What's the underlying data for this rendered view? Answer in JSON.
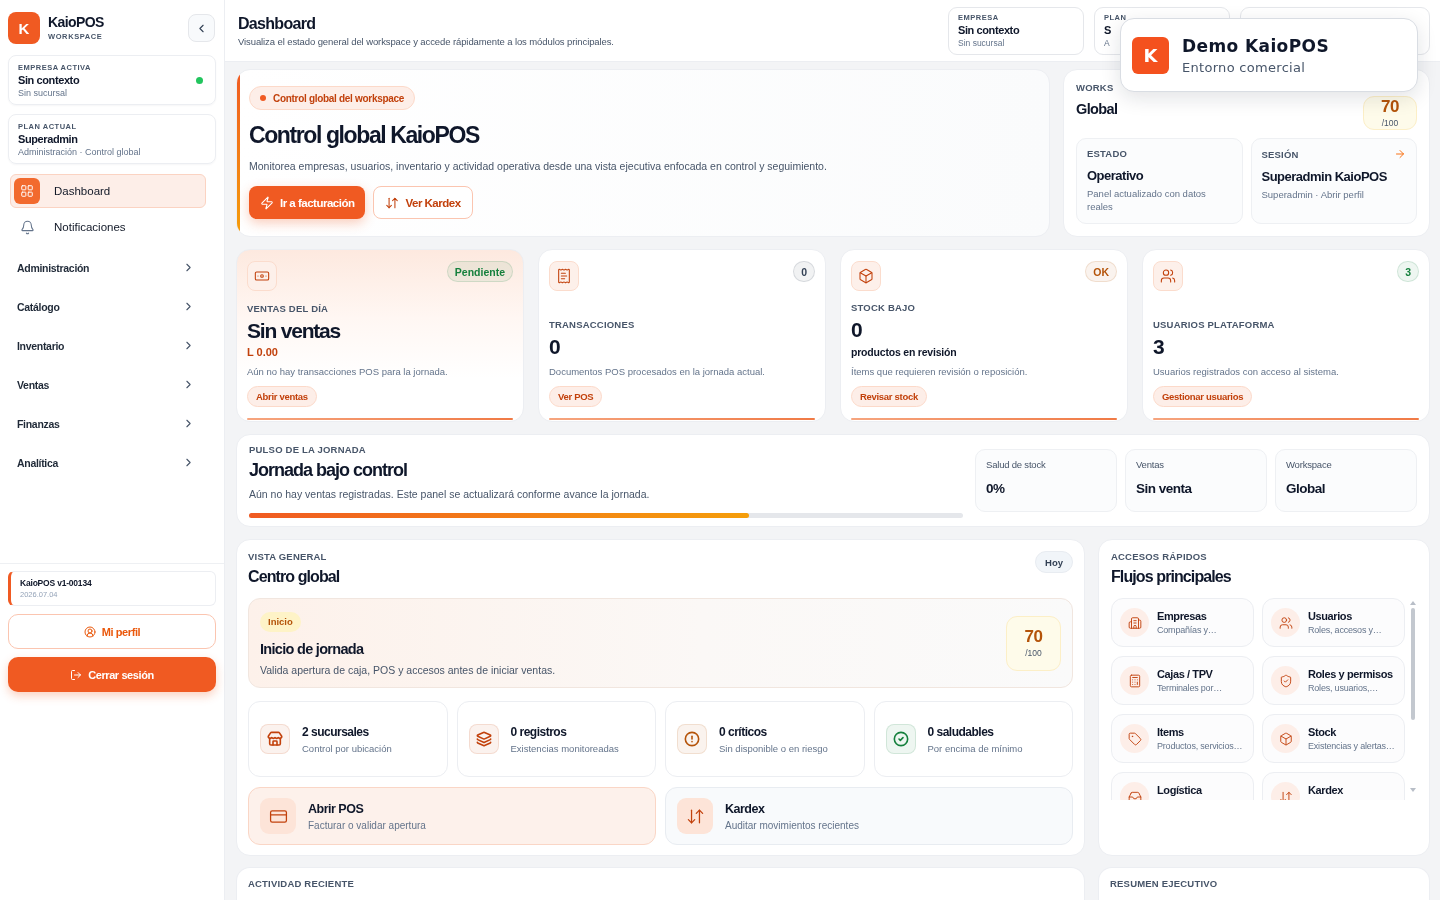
{
  "sidebar": {
    "brand": {
      "logo": "K",
      "name": "KaioPOS",
      "subtitle": "WORKSPACE"
    },
    "context_cards": [
      {
        "label": "EMPRESA ACTIVA",
        "value": "Sin contexto",
        "detail": "Sin sucursal",
        "online": true
      },
      {
        "label": "PLAN ACTUAL",
        "value": "Superadmin",
        "detail": "Administración · Control global"
      }
    ],
    "nav_items": [
      {
        "label": "Dashboard",
        "selected": true
      },
      {
        "label": "Notificaciones",
        "selected": false
      }
    ],
    "nav_groups": [
      {
        "label": "Administración",
        "expanded": false
      },
      {
        "label": "Catálogo",
        "expanded": false
      },
      {
        "label": "Inventario",
        "expanded": false
      },
      {
        "label": "Ventas",
        "expanded": false
      },
      {
        "label": "Finanzas",
        "expanded": false
      },
      {
        "label": "Analítica",
        "expanded": false
      }
    ],
    "version": {
      "name": "KaioPOS v1-00134",
      "date": "2026.07.04"
    },
    "buttons": [
      {
        "label": "Mi perfil",
        "kind": "outline"
      },
      {
        "label": "Cerrar sesión",
        "kind": "primary"
      }
    ]
  },
  "header": {
    "title": "Dashboard",
    "subtitle": "Visualiza el estado general del workspace y accede rápidamente a los módulos principales.",
    "context_cards": [
      {
        "kind": "info",
        "label": "EMPRESA",
        "value": "Sin contexto",
        "detail": "Sin sucursal"
      },
      {
        "kind": "info",
        "label": "PLAN",
        "value": "S",
        "detail": "A"
      },
      {
        "kind": "account"
      }
    ]
  },
  "toast": {
    "logo": "K",
    "title": "Demo KaioPOS",
    "subtitle": "Entorno comercial"
  },
  "hero": {
    "badge": "Control global del workspace",
    "title": "Control global KaioPOS",
    "description": "Monitorea empresas, usuarios, inventario y actividad operativa desde una vista ejecutiva enfocada en control y seguimiento.",
    "buttons": [
      {
        "label": "Ir a facturación",
        "kind": "primary"
      },
      {
        "label": "Ver Kardex",
        "kind": "outline"
      }
    ]
  },
  "workspace": {
    "label": "WORKS",
    "value": "Global",
    "score": "70",
    "score_max": "/100",
    "tiles": [
      {
        "label": "ESTADO",
        "value": "Operativo",
        "detail": "Panel actualizado con datos reales",
        "link": false
      },
      {
        "label": "SESIÓN",
        "value": "Superadmin KaioPOS",
        "detail": "Superadmin · Abrir perfil",
        "link": true
      }
    ]
  },
  "stats": [
    {
      "label": "VENTAS DEL DÍA",
      "value": "Sin ventas",
      "amount": "L 0.00",
      "description": "Aún no hay transacciones POS para la jornada.",
      "action": "Abrir ventas",
      "badge": {
        "text": "Pendiente",
        "color": "#15803d"
      },
      "highlighted": true
    },
    {
      "label": "TRANSACCIONES",
      "value": "0",
      "description": "Documentos POS procesados en la jornada actual.",
      "action": "Ver POS",
      "badge": {
        "text": "0",
        "color": "#334155"
      },
      "highlighted": false
    },
    {
      "label": "STOCK BAJO",
      "value": "0",
      "note": "productos en revisión",
      "description": "Ítems que requieren revisión o reposición.",
      "action": "Revisar stock",
      "badge": {
        "text": "OK",
        "color": "#b45309"
      },
      "highlighted": false
    },
    {
      "label": "USUARIOS PLATAFORMA",
      "value": "3",
      "description": "Usuarios registrados con acceso al sistema.",
      "action": "Gestionar usuarios",
      "badge": {
        "text": "3",
        "color": "#15803d"
      },
      "highlighted": false
    }
  ],
  "pulse": {
    "label": "PULSO DE LA JORNADA",
    "title": "Jornada bajo control",
    "description": "Aún no hay ventas registradas. Este panel se actualizará conforme avance la jornada.",
    "level": 0.7,
    "metrics": [
      {
        "label": "Salud de stock",
        "value": "0%"
      },
      {
        "label": "Ventas",
        "value": "Sin venta"
      },
      {
        "label": "Workspace",
        "value": "Global"
      }
    ]
  },
  "overview": {
    "label": "VISTA GENERAL",
    "title": "Centro global",
    "period": "Hoy",
    "focus": {
      "badge": "Inicio",
      "title": "Inicio de jornada",
      "description": "Valida apertura de caja, POS y accesos antes de iniciar ventas.",
      "score": "70",
      "score_max": "/100"
    },
    "metrics": [
      {
        "title": "2 sucursales",
        "description": "Control por ubicación",
        "color": "#c2410c"
      },
      {
        "title": "0 registros",
        "description": "Existencias monitoreadas",
        "color": "#c2410c"
      },
      {
        "title": "0 críticos",
        "description": "Sin disponible o en riesgo",
        "color": "#b45309"
      },
      {
        "title": "0 saludables",
        "description": "Por encima de mínimo",
        "color": "#15803d"
      }
    ],
    "actions": [
      {
        "title": "Abrir POS",
        "description": "Facturar o validar apertura",
        "highlighted": true
      },
      {
        "title": "Kardex",
        "description": "Auditar movimientos recientes",
        "highlighted": false
      }
    ]
  },
  "quick_access": {
    "label": "ACCESOS RÁPIDOS",
    "title": "Flujos principales",
    "items": [
      {
        "title": "Empresas",
        "description": "Compañías y…"
      },
      {
        "title": "Usuarios",
        "description": "Roles, accesos y…"
      },
      {
        "title": "Cajas / TPV",
        "description": "Terminales por…"
      },
      {
        "title": "Roles y permisos",
        "description": "Roles, usuarios,…"
      },
      {
        "title": "Items",
        "description": "Productos, servicios…"
      },
      {
        "title": "Stock",
        "description": "Existencias y alertas…"
      },
      {
        "title": "Logística"
      },
      {
        "title": "Kardex"
      }
    ]
  },
  "recent_activity": {
    "label": "ACTIVIDAD RECIENTE"
  },
  "executive_summary": {
    "label": "RESUMEN EJECUTIVO"
  }
}
